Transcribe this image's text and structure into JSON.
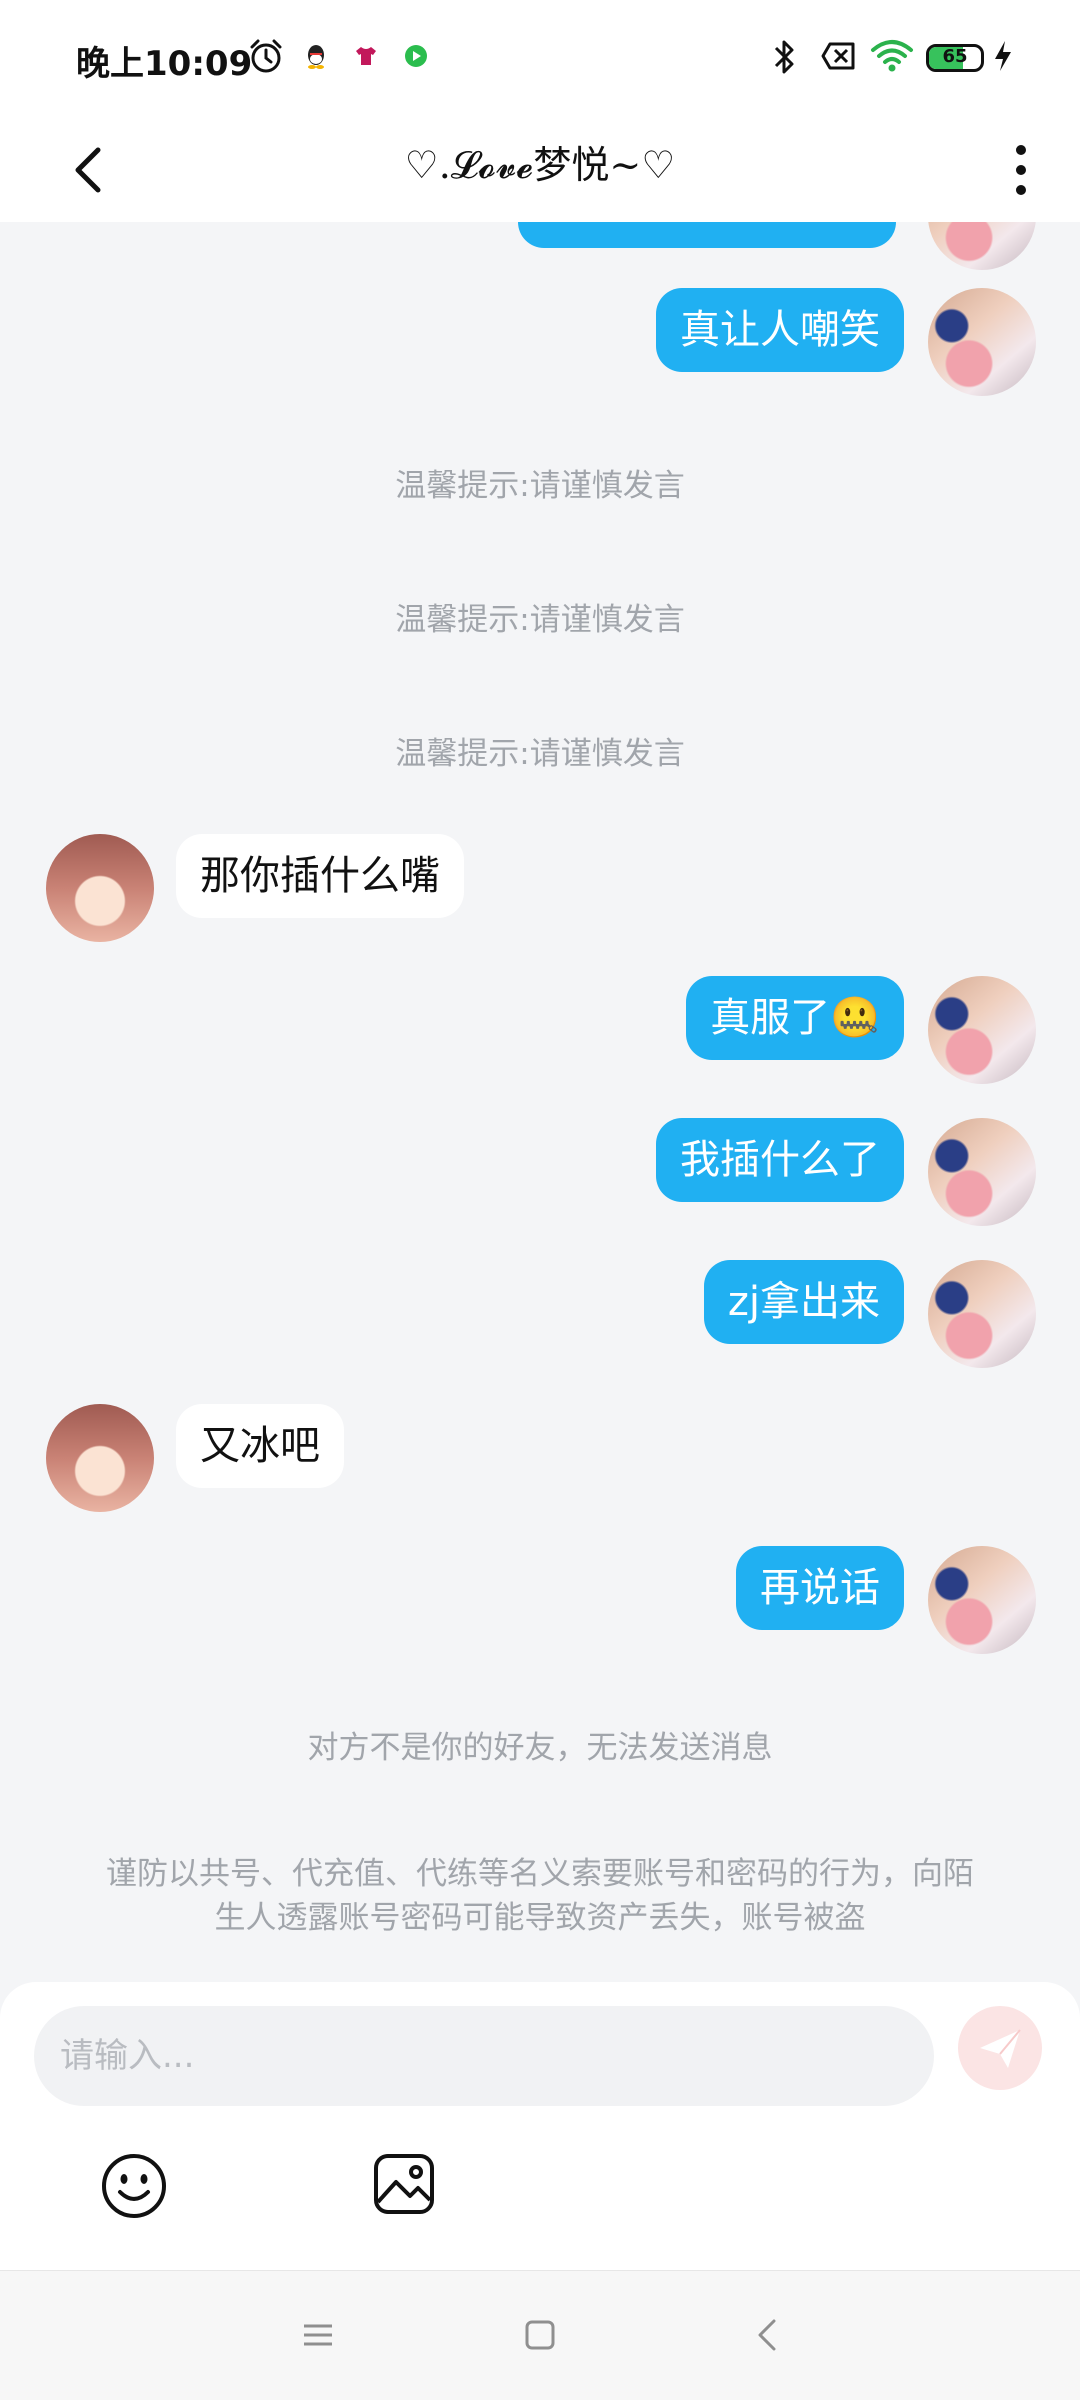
{
  "status_bar": {
    "time": "晚上10:09",
    "battery_percent": 65,
    "battery_label": "65",
    "icons": [
      "alarm-icon",
      "qq-icon",
      "tshirt-app-icon",
      "video-app-icon",
      "bluetooth-icon",
      "sim-off-icon",
      "wifi-icon",
      "battery-icon",
      "charging-icon"
    ]
  },
  "header": {
    "title": "♡.𝓛𝓸𝓿𝓮梦悦~♡",
    "back_icon": "chevron-left-icon",
    "more_icon": "more-vertical-icon"
  },
  "messages": [
    {
      "id": "m1",
      "from": "me",
      "text": "真让人嘲笑"
    },
    {
      "id": "t1",
      "type": "system",
      "text": "温馨提示:请谨慎发言"
    },
    {
      "id": "t2",
      "type": "system",
      "text": "温馨提示:请谨慎发言"
    },
    {
      "id": "t3",
      "type": "system",
      "text": "温馨提示:请谨慎发言"
    },
    {
      "id": "m2",
      "from": "other",
      "text": "那你插什么嘴"
    },
    {
      "id": "m3",
      "from": "me",
      "text": "真服了🤐"
    },
    {
      "id": "m4",
      "from": "me",
      "text": "我插什么了"
    },
    {
      "id": "m5",
      "from": "me",
      "text": "zj拿出来"
    },
    {
      "id": "m6",
      "from": "other",
      "text": "又冰吧"
    },
    {
      "id": "m7",
      "from": "me",
      "text": "再说话"
    }
  ],
  "not_friend_notice": "对方不是你的好友，无法发送消息",
  "safety_notice_line1": "谨防以共号、代充值、代练等名义索要账号和密码的行为，向陌",
  "safety_notice_line2": "生人透露账号密码可能导致资产丢失，账号被盗",
  "input": {
    "placeholder": "请输入...",
    "value": "",
    "send_icon": "paper-plane-icon",
    "toolbar_icons": [
      "smiley-icon",
      "image-icon"
    ]
  },
  "nav_bar": {
    "icons": [
      "menu-icon",
      "home-icon",
      "back-icon"
    ]
  },
  "colors": {
    "outgoing_bubble": "#20b0f2",
    "incoming_bubble": "#ffffff",
    "chat_background": "#f4f5f7",
    "hint_text": "#a1a5ab",
    "send_button": "#fbe4e4",
    "battery_fill": "#37c25c"
  }
}
